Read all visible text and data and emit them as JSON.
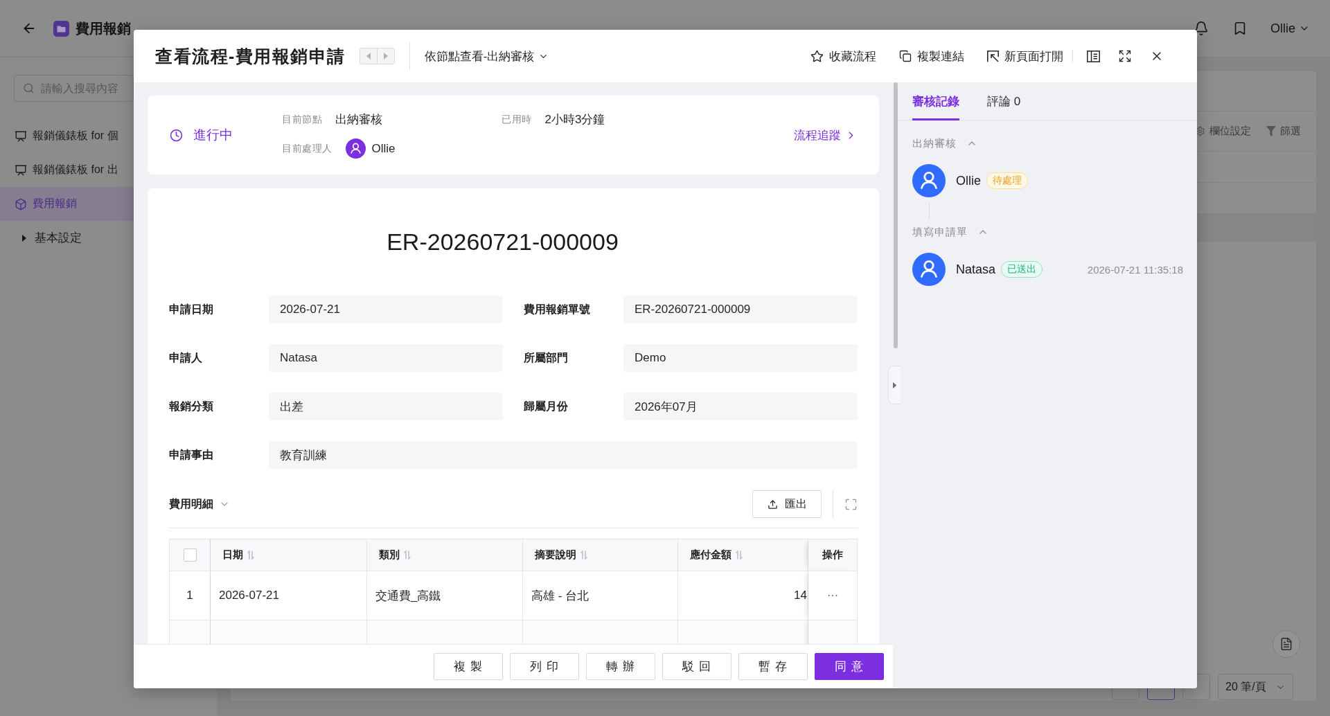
{
  "app_header": {
    "title": "費用報銷",
    "user": "Ollie"
  },
  "sidebar": {
    "search": {
      "placeholder": "請輸入搜尋內容"
    },
    "items": [
      {
        "label": "報銷儀錶板 for 個",
        "kind": "dashboard",
        "selected": false
      },
      {
        "label": "報銷儀錶板 for 出",
        "kind": "dashboard",
        "selected": false
      },
      {
        "label": "費用報銷",
        "kind": "module",
        "selected": true,
        "children": [
          {
            "label": "基本設定",
            "expanded": false
          }
        ]
      }
    ]
  },
  "list_page": {
    "toolbar": [
      {
        "kind": "settings",
        "label": "欄位設定"
      },
      {
        "kind": "filter",
        "label": "篩選"
      }
    ],
    "pagination": {
      "pages": [
        {
          "selected": false
        },
        {
          "selected": true
        },
        {
          "selected": false
        }
      ],
      "page_size": "20 筆/頁"
    }
  },
  "modal": {
    "title": "查看流程-費用報銷申請",
    "view_mode": "依節點查看-出納審核",
    "actions": [
      {
        "kind": "star",
        "label": "收藏流程"
      },
      {
        "kind": "copy",
        "label": "複製連結"
      },
      {
        "kind": "open",
        "label": "新頁面打開"
      }
    ],
    "status": {
      "state": "進行中",
      "fields": [
        {
          "label": "目前節點",
          "value": "出納審核",
          "kind": "text"
        },
        {
          "label": "已用時",
          "value": "2小時3分鐘",
          "kind": "text"
        },
        {
          "label": "目前處理人",
          "value": "Ollie",
          "kind": "user"
        }
      ],
      "link": "流程追蹤"
    },
    "form": {
      "title": "ER-20260721-000009",
      "fields": [
        {
          "label": "申請日期",
          "value": "2026-07-21",
          "kind": "half"
        },
        {
          "label": "費用報銷單號",
          "value": "ER-20260721-000009",
          "kind": "half"
        },
        {
          "label": "申請人",
          "value": "Natasa",
          "kind": "half"
        },
        {
          "label": "所屬部門",
          "value": "Demo",
          "kind": "half"
        },
        {
          "label": "報銷分類",
          "value": "出差",
          "kind": "half"
        },
        {
          "label": "歸屬月份",
          "value": "2026年07月",
          "kind": "half"
        },
        {
          "label": "申請事由",
          "value": "教育訓練",
          "kind": "full"
        }
      ]
    },
    "details": {
      "title": "費用明細",
      "expanded": true,
      "export": "匯出",
      "select_all": {
        "checked": false
      },
      "columns": [
        {
          "label": "日期",
          "sortable": true,
          "kind": "text"
        },
        {
          "label": "類別",
          "sortable": true,
          "kind": "text"
        },
        {
          "label": "摘要說明",
          "sortable": true,
          "kind": "text"
        },
        {
          "label": "應付金額",
          "sortable": true,
          "kind": "amount"
        }
      ],
      "action_column": "操作",
      "rows": [
        {
          "index": "1",
          "cells": [
            "2026-07-21",
            "交通費_高鐵",
            "高雄 - 台北",
            "14"
          ],
          "action": "···"
        }
      ]
    },
    "footer_buttons": [
      {
        "label": "複 製",
        "primary": false
      },
      {
        "label": "列 印",
        "primary": false
      },
      {
        "label": "轉 辦",
        "primary": false
      },
      {
        "label": "駁 回",
        "primary": false
      },
      {
        "label": "暫 存",
        "primary": false
      },
      {
        "label": "同 意",
        "primary": true
      }
    ],
    "side_panel": {
      "tabs": [
        {
          "label": "審核記錄",
          "selected": true
        },
        {
          "label": "評論 0",
          "selected": false
        }
      ],
      "records": [
        {
          "node": "出納審核",
          "expanded": true,
          "entries": [
            {
              "name": "Ollie",
              "status": "待處理",
              "kind": "pending"
            }
          ]
        },
        {
          "node": "填寫申請單",
          "expanded": true,
          "entries": [
            {
              "name": "Natasa",
              "status": "已送出",
              "kind": "sent",
              "time": "2026-07-21 11:35:18"
            }
          ]
        }
      ]
    }
  }
}
